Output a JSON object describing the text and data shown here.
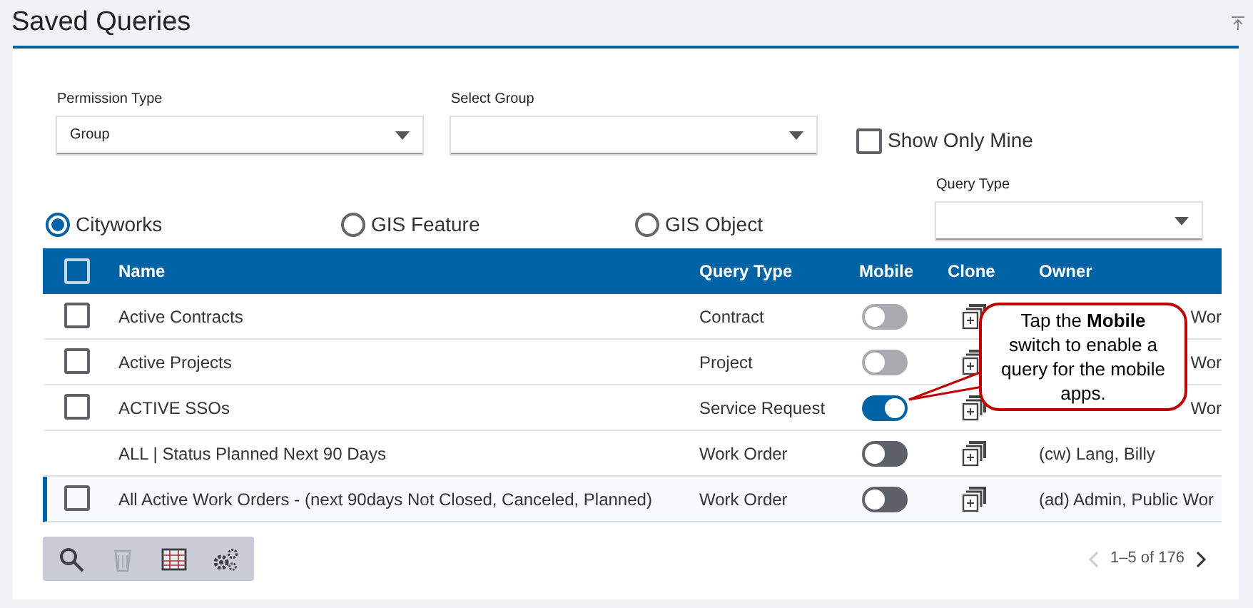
{
  "title": "Saved Queries",
  "filters": {
    "permission_type": {
      "label": "Permission Type",
      "value": "Group"
    },
    "select_group": {
      "label": "Select Group"
    },
    "show_only_mine": {
      "label": "Show Only Mine",
      "checked": false
    },
    "query_type": {
      "label": "Query Type"
    }
  },
  "sources": [
    {
      "label": "Cityworks",
      "selected": true
    },
    {
      "label": "GIS Feature",
      "selected": false
    },
    {
      "label": "GIS Object",
      "selected": false
    }
  ],
  "table": {
    "columns": [
      "Name",
      "Query Type",
      "Mobile",
      "Clone",
      "Owner"
    ],
    "select_all_checked": false,
    "rows": [
      {
        "kind": "checkbox",
        "name": "Active Contracts",
        "query_type": "Contract",
        "mobile": false,
        "mobile_disabled": true,
        "checked": false,
        "selected": false,
        "owner": "Wor"
      },
      {
        "kind": "checkbox",
        "name": "Active Projects",
        "query_type": "Project",
        "mobile": false,
        "mobile_disabled": true,
        "checked": false,
        "selected": false,
        "owner": "Wor"
      },
      {
        "kind": "checkbox",
        "name": "ACTIVE SSOs",
        "query_type": "Service Request",
        "mobile": true,
        "mobile_disabled": false,
        "checked": false,
        "selected": false,
        "owner": "Wor"
      },
      {
        "kind": "plain",
        "name": "ALL | Status Planned Next 90 Days",
        "query_type": "Work Order",
        "mobile": false,
        "mobile_disabled": false,
        "selected": false,
        "owner": "(cw) Lang, Billy"
      },
      {
        "kind": "checkbox",
        "name": "All Active Work Orders - (next 90days Not Closed, Canceled, Planned)",
        "query_type": "Work Order",
        "mobile": false,
        "mobile_disabled": false,
        "checked": false,
        "selected": true,
        "owner": "(ad) Admin, Public Wor"
      }
    ]
  },
  "toolbar": [
    {
      "kind": "search",
      "disabled": false
    },
    {
      "kind": "delete",
      "disabled": true
    },
    {
      "kind": "grid",
      "disabled": false
    },
    {
      "kind": "settings",
      "disabled": false
    }
  ],
  "pagination": {
    "range": "1–5 of 176",
    "prev_disabled": true,
    "next_disabled": false
  },
  "callout": "Tap the **Mobile** switch to enable a query for the mobile apps."
}
